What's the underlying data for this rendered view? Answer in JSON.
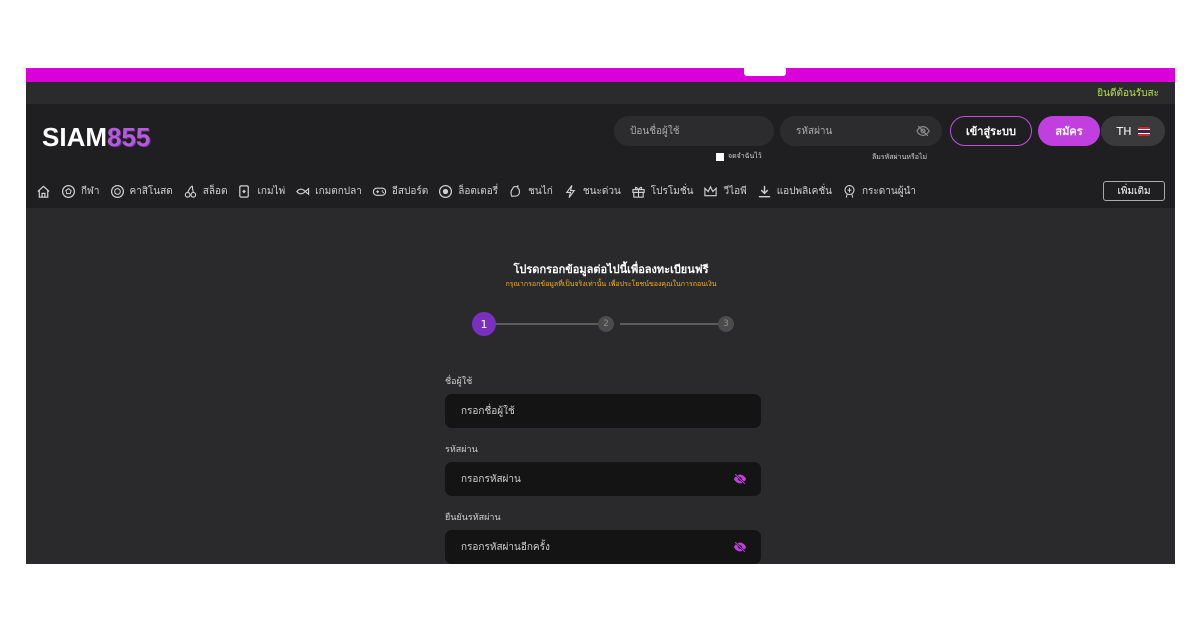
{
  "marquee": {
    "text": "ยินดีต้อนรับสะ"
  },
  "header": {
    "logo_text": "SIAM",
    "logo_number": "855",
    "username_placeholder": "ป้อนชื่อผู้ใช้",
    "password_placeholder": "รหัสผ่าน",
    "remember_label": "จดจำฉันไว้",
    "forgot_label": "ลืมรหัสผ่านหรือไม่",
    "login_label": "เข้าสู่ระบบ",
    "signup_label": "สมัคร",
    "lang_label": "TH"
  },
  "nav": {
    "items": [
      {
        "label": "",
        "icon": "home-icon"
      },
      {
        "label": "กีฬา",
        "icon": "soccer-ball-icon"
      },
      {
        "label": "คาสิโนสด",
        "icon": "casino-chip-icon"
      },
      {
        "label": "สล็อต",
        "icon": "cherries-icon"
      },
      {
        "label": "เกมไพ่",
        "icon": "cards-icon"
      },
      {
        "label": "เกมตกปลา",
        "icon": "fish-icon"
      },
      {
        "label": "อีสปอร์ต",
        "icon": "gamepad-icon"
      },
      {
        "label": "ล็อตเตอรี่",
        "icon": "lottery-ball-icon"
      },
      {
        "label": "ชนไก่",
        "icon": "rooster-icon"
      },
      {
        "label": "ชนะด่วน",
        "icon": "lightning-icon"
      },
      {
        "label": "โปรโมชั่น",
        "icon": "gift-icon"
      },
      {
        "label": "วีไอพี",
        "icon": "crown-icon"
      },
      {
        "label": "แอปพลิเคชั่น",
        "icon": "download-icon"
      },
      {
        "label": "กระดานผู้นำ",
        "icon": "leaderboard-icon"
      }
    ],
    "more_label": "เพิ่มเติม"
  },
  "form": {
    "title": "โปรดกรอกข้อมูลต่อไปนี้เพื่อลงทะเบียนฟรี",
    "subtitle": "กรุณากรอกข้อมูลที่เป็นจริงเท่านั้น เพื่อประโยชน์ของคุณในการถอนเงิน",
    "steps": [
      "1",
      "2",
      "3"
    ],
    "username_label": "ชื่อผู้ใช้",
    "username_placeholder": "กรอกชื่อผู้ใช้",
    "password_label": "รหัสผ่าน",
    "password_placeholder": "กรอกรหัสผ่าน",
    "confirm_label": "ยืนยันรหัสผ่าน",
    "confirm_placeholder": "กรอกรหัสผ่านอีกครั้ง"
  },
  "colors": {
    "accent": "#c03fde",
    "top_bar": "#d900d9",
    "step_active": "#7a2fbf",
    "subtitle": "#f2b21b",
    "marquee_text": "#b6e24a",
    "eye_icon": "#c03fde"
  }
}
